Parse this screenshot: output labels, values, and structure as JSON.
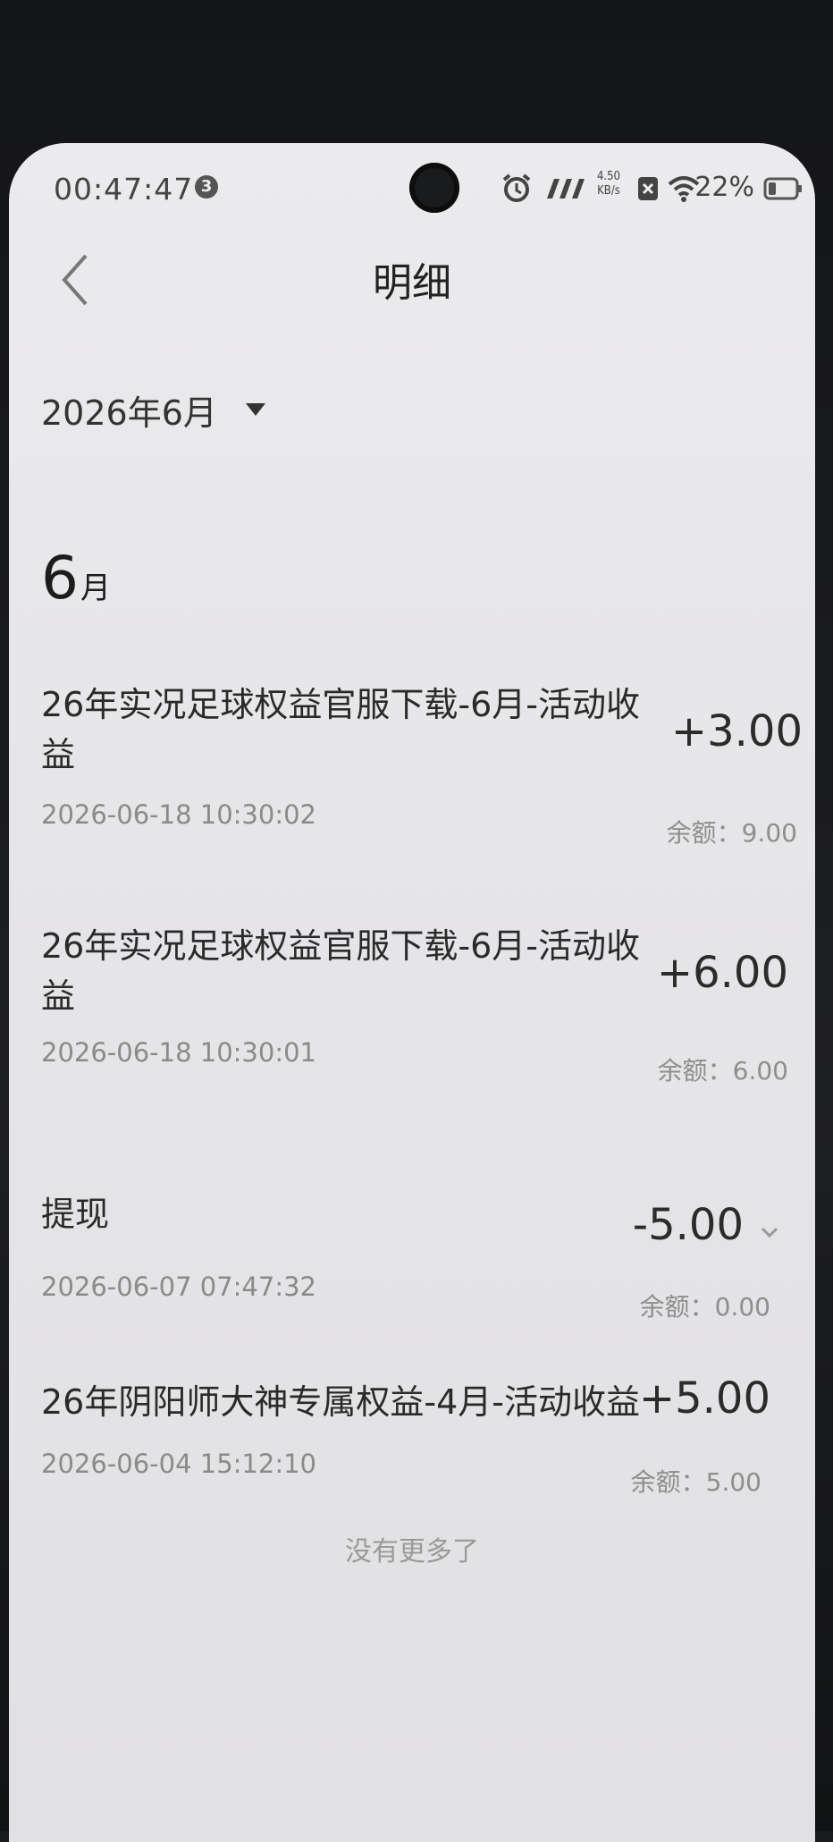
{
  "status_bar": {
    "time": "00:47:47",
    "notification_count": "3",
    "net_speed_value": "4.50",
    "net_speed_unit": "KB/s",
    "battery": "22%"
  },
  "header": {
    "title": "明细"
  },
  "filter": {
    "month_label": "2026年6月"
  },
  "section": {
    "month_number": "6",
    "month_unit": "月"
  },
  "transactions": [
    {
      "title_line1": "26年实况足球权益官服下载-6月-活动收",
      "title_line2": "益",
      "amount": "+3.00",
      "datetime": "2026-06-18 10:30:02",
      "balance": "余额：9.00"
    },
    {
      "title_line1": "26年实况足球权益官服下载-6月-活动收",
      "title_line2": "益",
      "amount": "+6.00",
      "datetime": "2026-06-18 10:30:01",
      "balance": "余额：6.00"
    },
    {
      "title_line1": "提现",
      "amount": "-5.00",
      "datetime": "2026-06-07 07:47:32",
      "balance": "余额：0.00"
    },
    {
      "title_line1": "26年阴阳师大神专属权益-4月-活动收益",
      "amount": "+5.00",
      "datetime": "2026-06-04 15:12:10",
      "balance": "余额：5.00"
    }
  ],
  "footer": {
    "no_more": "没有更多了"
  },
  "icons": {
    "back": "back-arrow-icon",
    "caret": "caret-down-icon",
    "expand": "chevron-down-icon",
    "alarm": "alarm-icon",
    "signal": "signal-icon",
    "wifi": "wifi-icon",
    "battery": "battery-icon"
  },
  "colors": {
    "background": "#e8e7ea",
    "text_primary": "#2a2a2a",
    "text_secondary": "#8a8a8a"
  }
}
